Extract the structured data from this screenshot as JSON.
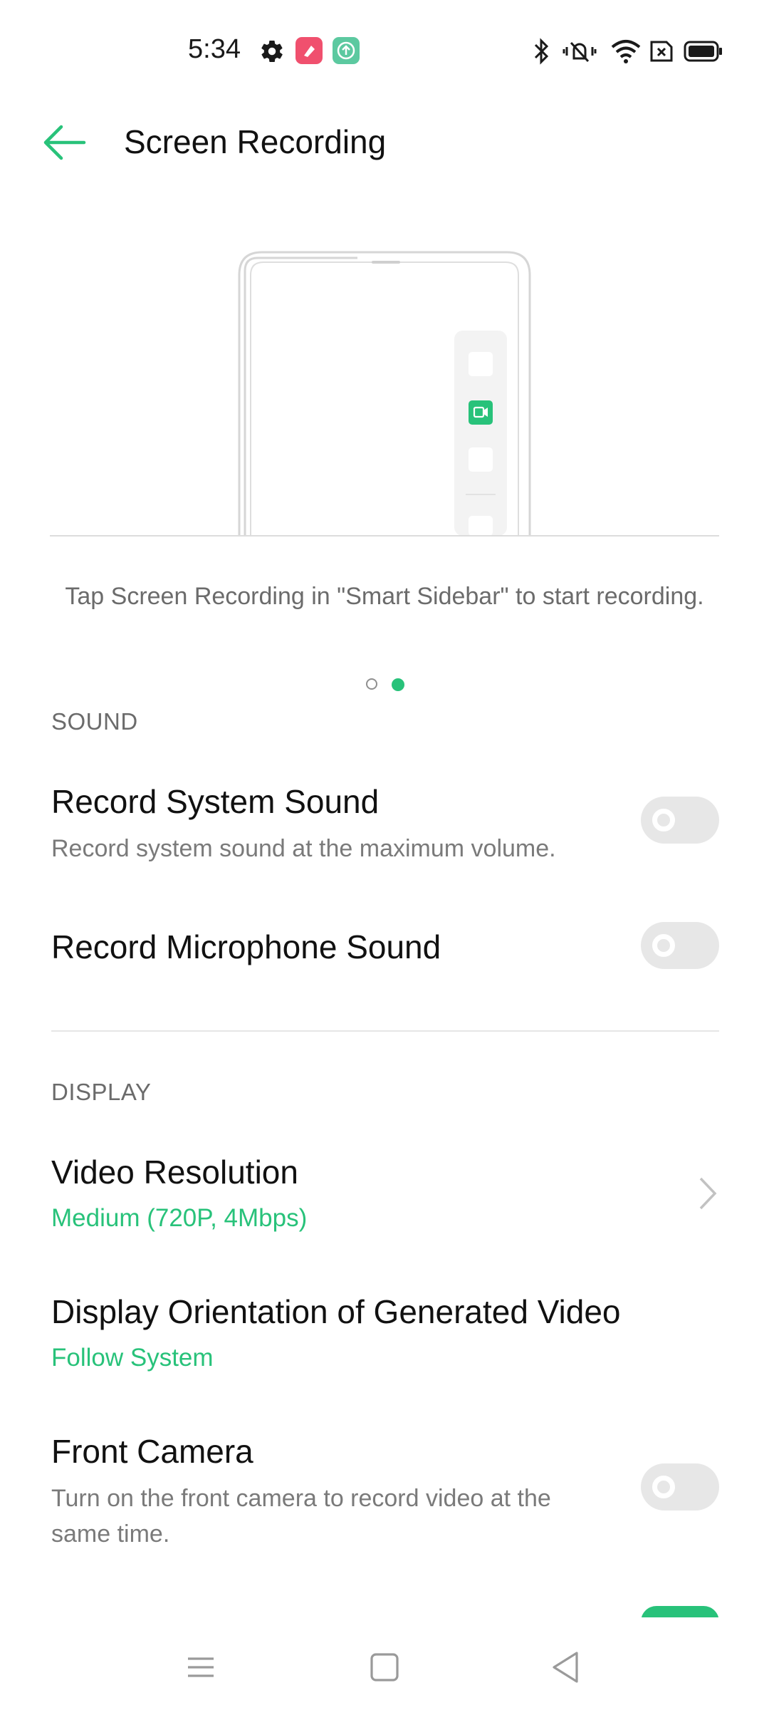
{
  "status_bar": {
    "time": "5:34",
    "left_icons": [
      "settings-icon",
      "app-notification-icon",
      "upload-notification-icon"
    ],
    "right_icons": [
      "bluetooth-icon",
      "vibrate-icon",
      "wifi-icon",
      "no-sim-icon",
      "battery-icon"
    ]
  },
  "header": {
    "title": "Screen Recording",
    "back_icon": "back-arrow-icon"
  },
  "illustration": {
    "tip": "Tap Screen Recording in \"Smart Sidebar\" to start recording.",
    "pages": 2,
    "active_page": 2
  },
  "sections": {
    "sound": {
      "header": "SOUND",
      "record_system_sound": {
        "title": "Record System Sound",
        "subtitle": "Record system sound at the maximum volume.",
        "enabled": false
      },
      "record_microphone_sound": {
        "title": "Record Microphone Sound",
        "enabled": false
      }
    },
    "display": {
      "header": "DISPLAY",
      "video_resolution": {
        "title": "Video Resolution",
        "value": "Medium (720P, 4Mbps)"
      },
      "display_orientation": {
        "title": "Display Orientation of Generated Video",
        "value": "Follow System"
      },
      "front_camera": {
        "title": "Front Camera",
        "subtitle_line1": "Turn on the front camera to record video at the",
        "subtitle_line2": "same time.",
        "enabled": false
      }
    }
  },
  "colors": {
    "accent": "#28c27a",
    "toggle_off": "#e7e7e7",
    "secondary_text": "#7a7a7a"
  },
  "nav_bar": {
    "icons": [
      "menu-icon",
      "home-icon",
      "back-icon"
    ]
  }
}
